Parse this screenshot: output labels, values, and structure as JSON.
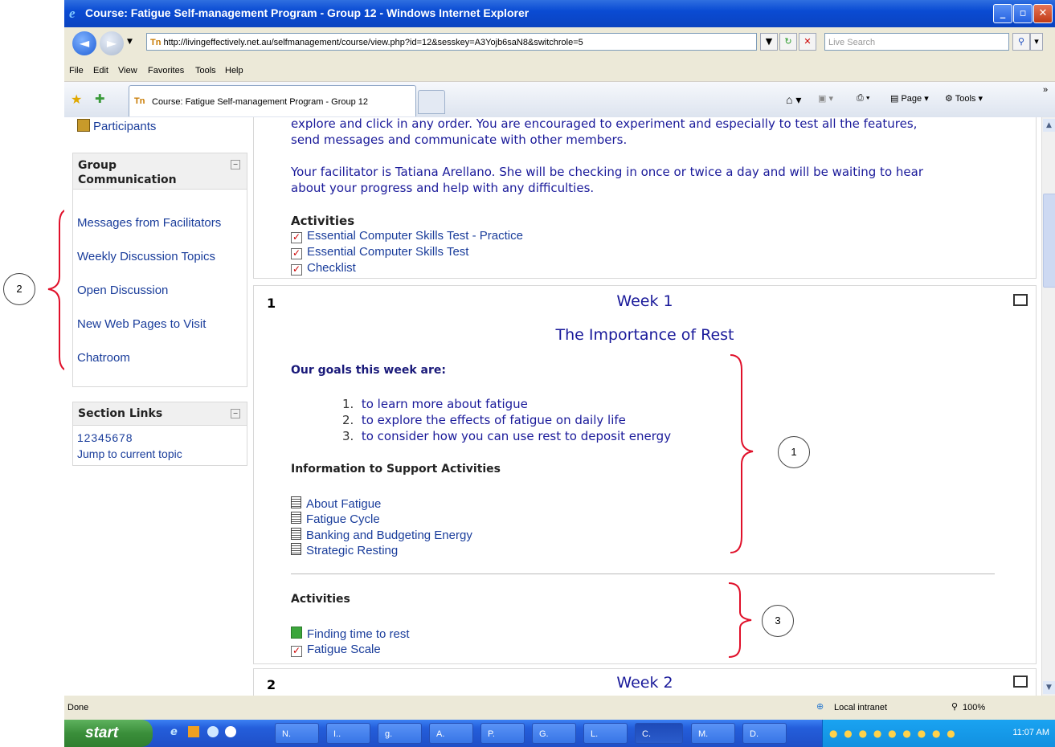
{
  "window": {
    "title": "Course: Fatigue Self-management Program - Group 12 - Windows Internet Explorer",
    "address": "http://livingeffectively.net.au/selfmanagement/course/view.php?id=12&sesskey=A3Yojb6saN8&switchrole=5",
    "search_placeholder": "Live Search",
    "tab_title": "Course: Fatigue Self-management Program - Group 12"
  },
  "menu": [
    "File",
    "Edit",
    "View",
    "Favorites",
    "Tools",
    "Help"
  ],
  "command_bar": {
    "page": "Page ▾",
    "tools": "Tools ▾"
  },
  "sidebar": {
    "participants": "Participants",
    "group_title": "Group Communication",
    "group_links": [
      "Messages from Facilitators",
      "Weekly Discussion Topics",
      "Open Discussion",
      "New Web Pages to Visit",
      "Chatroom"
    ],
    "section_title": "Section Links",
    "section_numbers": "1 2 3 4 5 6 7 8",
    "jump_link": "Jump to current topic"
  },
  "intro": {
    "line1": "explore and click in any order. You are encouraged to experiment and especially to test all the features,",
    "line2": "send messages and communicate with other members.",
    "facilitator1": "Your facilitator is Tatiana Arellano. She will be checking in once or twice a day and will be waiting to hear",
    "facilitator2": "about your progress and help with any difficulties.",
    "activities_label": "Activities",
    "activities": [
      "Essential Computer Skills Test - Practice",
      "Essential Computer Skills Test",
      "Checklist"
    ]
  },
  "week1": {
    "number": "1",
    "title": "Week 1",
    "subtitle": "The Importance of Rest",
    "goals_label": "Our goals this week are:",
    "goals": [
      "to learn more about fatigue",
      "to explore the effects of fatigue on daily life",
      "to consider how you can use rest to deposit energy"
    ],
    "info_label": "Information to Support Activities",
    "resources": [
      "About Fatigue",
      "Fatigue Cycle",
      "Banking and Budgeting Energy",
      "Strategic Resting"
    ],
    "activities_label": "Activities",
    "activities": [
      "Finding time to rest",
      "Fatigue Scale"
    ]
  },
  "week2": {
    "number": "2",
    "title": "Week 2"
  },
  "status": {
    "left": "Done",
    "zone": "Local intranet",
    "zoom": "100%"
  },
  "taskbar": {
    "start": "start",
    "buttons": [
      "N.",
      "I..",
      "g.",
      "A.",
      "P.",
      "G.",
      "L.",
      "C.",
      "M.",
      "D."
    ],
    "clock": "11:07 AM"
  },
  "callouts": [
    "1",
    "2",
    "3"
  ],
  "colors": {
    "link": "#1a3d9b",
    "text_blue": "#1a1a9a",
    "annotation": "#e0102a"
  }
}
